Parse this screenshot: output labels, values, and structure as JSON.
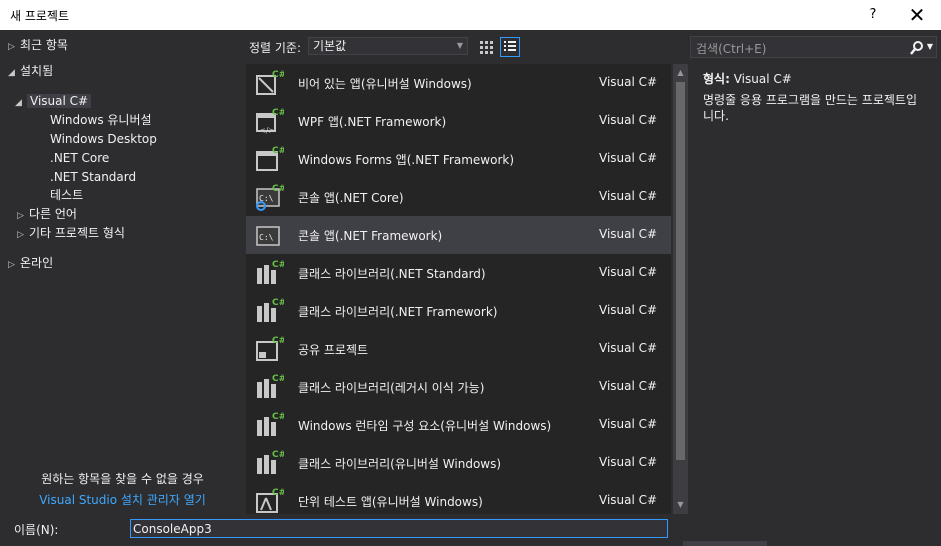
{
  "window": {
    "title": "새 프로젝트",
    "help": "?",
    "close": "✕"
  },
  "tree": {
    "items": [
      {
        "label": "최근 항목",
        "arrow": "▷"
      },
      {
        "label": "설치됨",
        "arrow": "◢"
      },
      {
        "label": "Visual C#",
        "arrow": "◢"
      },
      {
        "label": "Windows 유니버설",
        "arrow": ""
      },
      {
        "label": "Windows Desktop",
        "arrow": ""
      },
      {
        "label": ".NET Core",
        "arrow": ""
      },
      {
        "label": ".NET Standard",
        "arrow": ""
      },
      {
        "label": "테스트",
        "arrow": ""
      },
      {
        "label": "다른 언어",
        "arrow": "▷"
      },
      {
        "label": "기타 프로젝트 형식",
        "arrow": "▷"
      },
      {
        "label": "온라인",
        "arrow": "▷"
      }
    ],
    "not_found": "원하는 항목을 찾을 수 없을 경우",
    "installer_link": "Visual Studio 설치 관리자 열기"
  },
  "toolbar": {
    "sort_label": "정렬 기준:",
    "sort_value": "기본값",
    "search_placeholder": "검색(Ctrl+E)"
  },
  "templates": [
    {
      "name": "비어 있는 앱(유니버설 Windows)",
      "lang": "Visual C#",
      "icon": "blank-app-icon"
    },
    {
      "name": "WPF 앱(.NET Framework)",
      "lang": "Visual C#",
      "icon": "wpf-app-icon"
    },
    {
      "name": "Windows Forms 앱(.NET Framework)",
      "lang": "Visual C#",
      "icon": "winforms-app-icon"
    },
    {
      "name": "콘솔 앱(.NET Core)",
      "lang": "Visual C#",
      "icon": "console-core-icon"
    },
    {
      "name": "콘솔 앱(.NET Framework)",
      "lang": "Visual C#",
      "icon": "console-framework-icon"
    },
    {
      "name": "클래스 라이브러리(.NET Standard)",
      "lang": "Visual C#",
      "icon": "class-library-icon"
    },
    {
      "name": "클래스 라이브러리(.NET Framework)",
      "lang": "Visual C#",
      "icon": "class-library-icon"
    },
    {
      "name": "공유 프로젝트",
      "lang": "Visual C#",
      "icon": "shared-project-icon"
    },
    {
      "name": "클래스 라이브러리(레거시 이식 가능)",
      "lang": "Visual C#",
      "icon": "class-library-icon"
    },
    {
      "name": "Windows 런타임 구성 요소(유니버설 Windows)",
      "lang": "Visual C#",
      "icon": "runtime-component-icon"
    },
    {
      "name": "클래스 라이브러리(유니버설 Windows)",
      "lang": "Visual C#",
      "icon": "class-library-icon"
    },
    {
      "name": "단위 테스트 앱(유니버설 Windows)",
      "lang": "Visual C#",
      "icon": "unit-test-icon"
    }
  ],
  "description": {
    "type_label": "형식:",
    "type_value": "Visual C#",
    "text": "명령줄 응용 프로그램을 만드는 프로젝트입니다."
  },
  "name_field": {
    "label": "이름(N):",
    "value": "ConsoleApp3"
  },
  "colors": {
    "accent": "#3399ff",
    "link": "#3ea8ff",
    "csharp_green": "#68c046"
  }
}
